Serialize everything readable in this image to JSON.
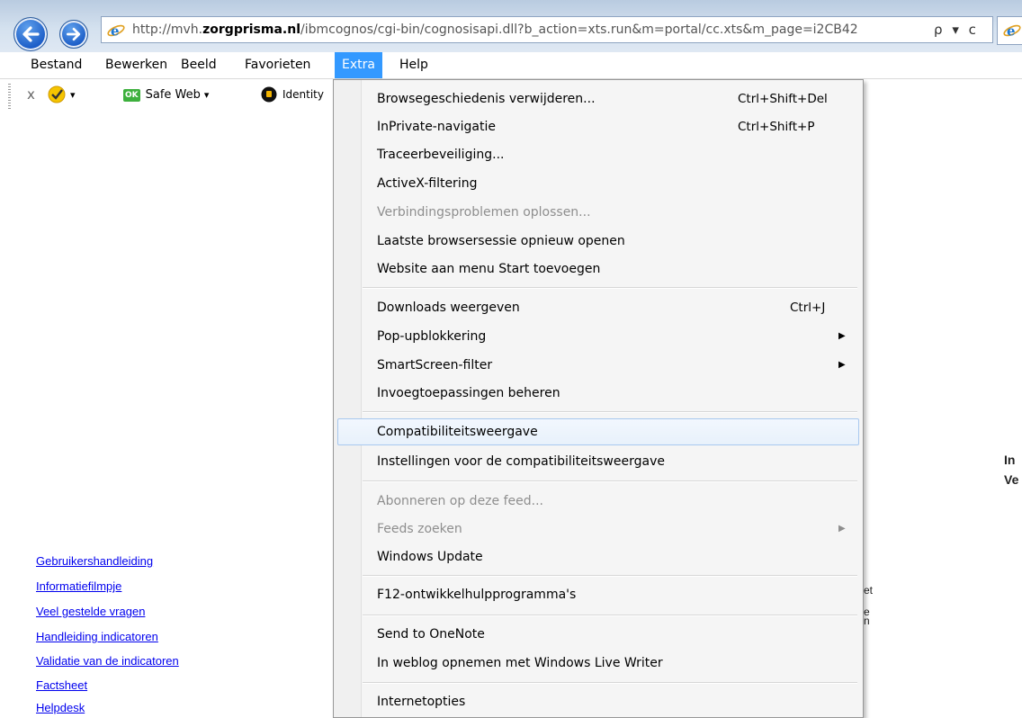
{
  "browser": {
    "url_prefix": "http://mvh.",
    "url_domain": "zorgprisma.nl",
    "url_rest": "/ibmcognos/cgi-bin/cognosisapi.dll?b_action=xts.run&m=portal/cc.xts&m_page=i2CB42",
    "search_glyph": "ρ",
    "dropdown_glyph": "▾",
    "refresh_glyph": "c"
  },
  "menubar": {
    "items": [
      "Bestand",
      "Bewerken",
      "Beeld",
      "Favorieten",
      "Extra",
      "Help"
    ],
    "active": "Extra"
  },
  "commandbar": {
    "close_glyph": "x",
    "check_dropdown_glyph": "▾",
    "ok_badge": "OK",
    "safe_web": "Safe Web",
    "safe_web_dropdown": "▾",
    "identity": "Identity"
  },
  "dropdown": {
    "items": [
      {
        "label": "Browsegeschiedenis verwijderen...",
        "shortcut": "Ctrl+Shift+Del"
      },
      {
        "label": "InPrivate-navigatie",
        "shortcut": "Ctrl+Shift+P"
      },
      {
        "label": "Traceerbeveiliging...",
        "shortcut": ""
      },
      {
        "label": "ActiveX-filtering",
        "shortcut": ""
      },
      {
        "label": "Verbindingsproblemen oplossen...",
        "shortcut": ""
      },
      {
        "label": "Laatste browsersessie opnieuw openen",
        "shortcut": ""
      },
      {
        "label": "Website aan menu Start toevoegen",
        "shortcut": ""
      },
      {
        "label": "Downloads weergeven",
        "shortcut": "Ctrl+J"
      },
      {
        "label": "Pop-upblokkering",
        "shortcut": ""
      },
      {
        "label": "SmartScreen-filter",
        "shortcut": ""
      },
      {
        "label": "Invoegtoepassingen beheren",
        "shortcut": ""
      },
      {
        "label": "Compatibiliteitsweergave",
        "shortcut": ""
      },
      {
        "label": "Instellingen voor de compatibiliteitsweergave",
        "shortcut": ""
      },
      {
        "label": "Abonneren op deze feed...",
        "shortcut": ""
      },
      {
        "label": "Feeds zoeken",
        "shortcut": ""
      },
      {
        "label": "Windows Update",
        "shortcut": ""
      },
      {
        "label": "F12-ontwikkelhulpprogramma's",
        "shortcut": ""
      },
      {
        "label": "Send to OneNote",
        "shortcut": ""
      },
      {
        "label": "In weblog opnemen met Windows Live Writer",
        "shortcut": ""
      },
      {
        "label": "Internetopties",
        "shortcut": ""
      }
    ],
    "submenu_arrow": "▶"
  },
  "page": {
    "links": [
      "Gebruikershandleiding",
      "Informatiefilmpje",
      "Veel gestelde vragen",
      "Handleiding indicatoren",
      "Validatie van de indicatoren",
      "Factsheet",
      "Helpdesk"
    ],
    "right_peek_1": "In",
    "right_peek_2": "Ve",
    "mid_peek_1": "et",
    "mid_peek_2": "e",
    "mid_peek_3": "n"
  },
  "colors": {
    "menu_active": "#3399ff",
    "link": "#0000ee",
    "highlight_border": "#a8c8ef"
  }
}
